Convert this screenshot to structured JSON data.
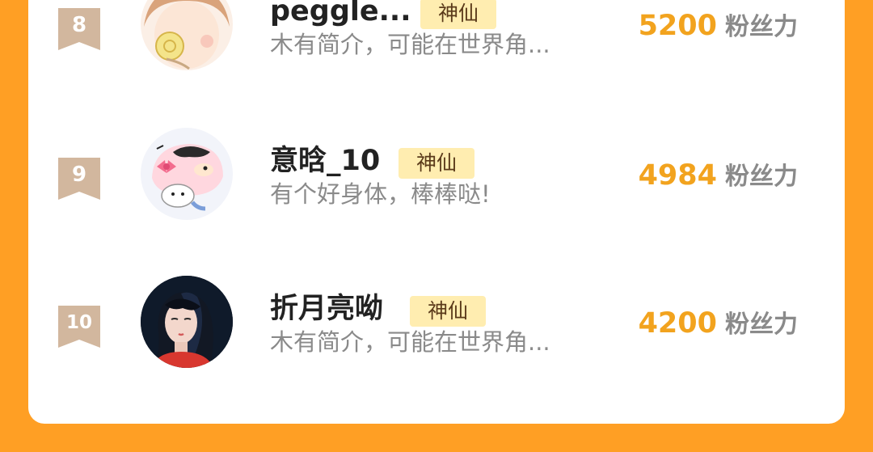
{
  "leaderboard": {
    "fans_unit": "粉丝力",
    "entries": [
      {
        "rank": "8",
        "name": "peggle...",
        "badge": "神仙",
        "intro": "木有简介，可能在世界角...",
        "fans": "5200",
        "avatar": "cartoon-girl-avatar"
      },
      {
        "rank": "9",
        "name": "意晗_10",
        "badge": "神仙",
        "intro": "有个好身体，棒棒哒!",
        "fans": "4984",
        "avatar": "crayon-shinchan-avatar"
      },
      {
        "rank": "10",
        "name": "折月亮呦",
        "badge": "神仙",
        "intro": "木有简介，可能在世界角...",
        "fans": "4200",
        "avatar": "illustrated-woman-avatar"
      }
    ]
  },
  "colors": {
    "background": "#FF9F24",
    "card": "#FFFFFF",
    "rank_flag": "#D2B79E",
    "badge_bg": "#FFEDB0",
    "fans_value": "#F2A31E",
    "secondary_text": "#8A8A8A"
  }
}
